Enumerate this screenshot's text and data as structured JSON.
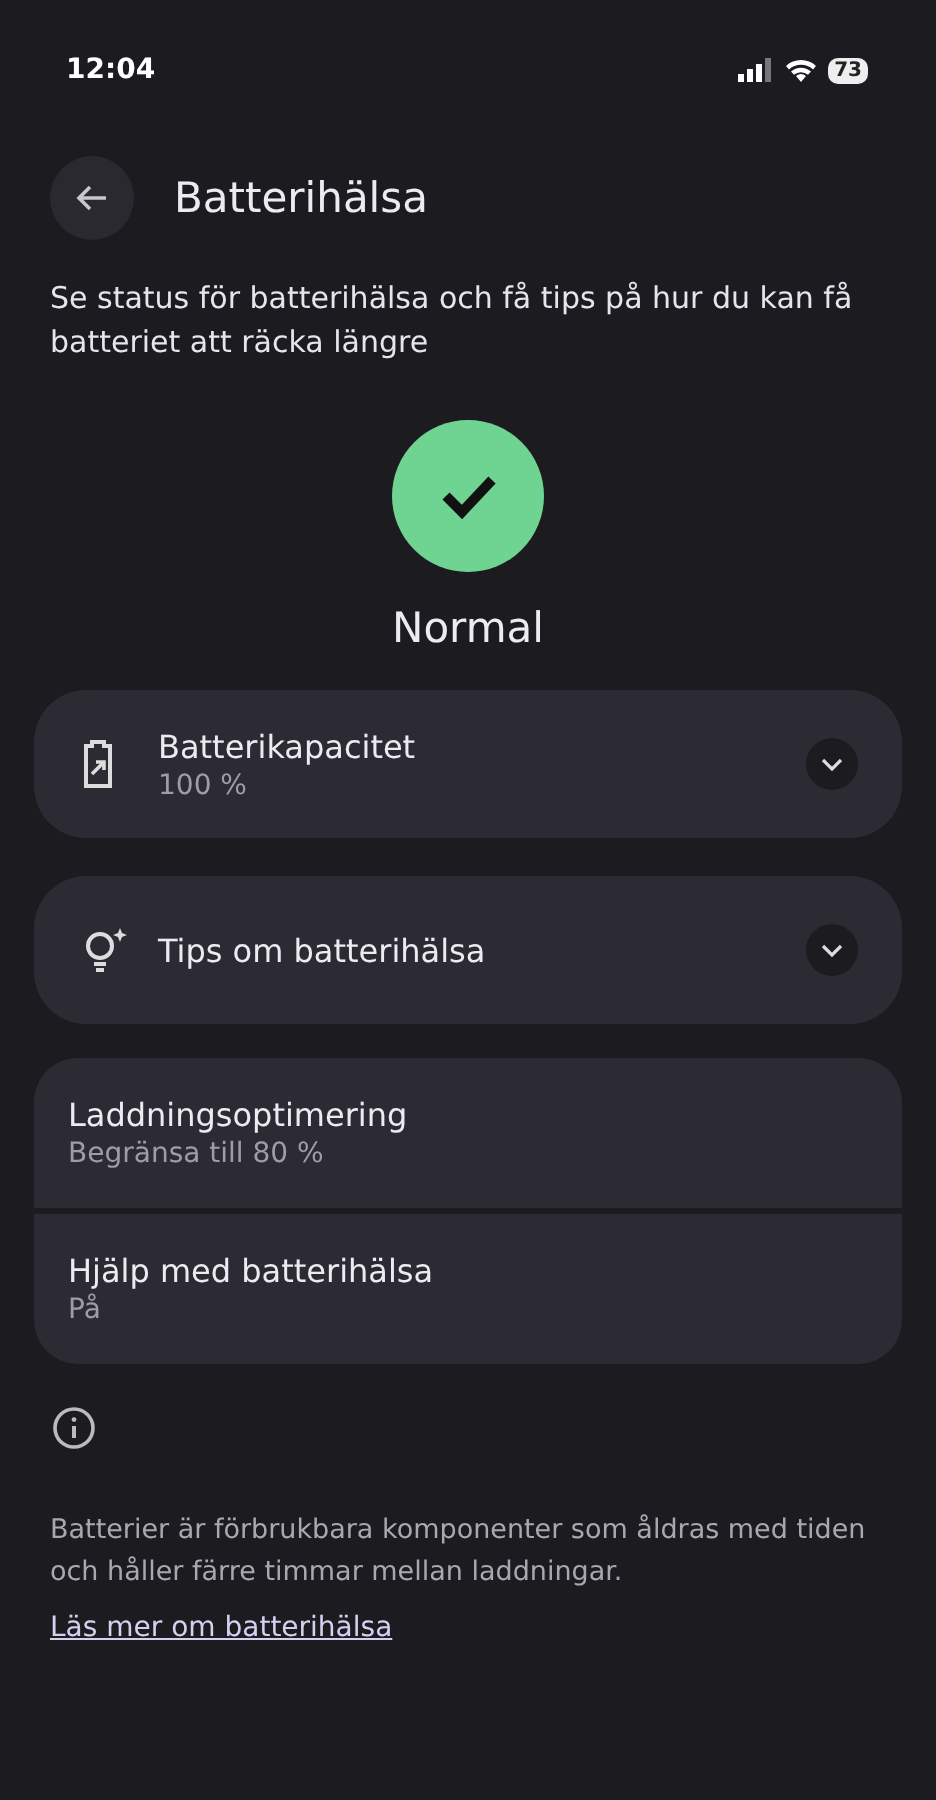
{
  "status_bar": {
    "time": "12:04",
    "battery": "73"
  },
  "header": {
    "title": "Batterihälsa"
  },
  "description": "Se status för batterihälsa och få tips på hur du kan få batteriet att räcka längre",
  "status": {
    "label": "Normal"
  },
  "expandables": [
    {
      "kind": "battery",
      "title": "Batterikapacitet",
      "subtitle": "100 %",
      "expanded": false
    },
    {
      "kind": "tips",
      "title": "Tips om batterihälsa",
      "expanded": false
    }
  ],
  "settings": [
    {
      "title": "Laddningsoptimering",
      "subtitle": "Begränsa till 80 %"
    },
    {
      "title": "Hjälp med batterihälsa",
      "subtitle": "På"
    }
  ],
  "footer": {
    "text": "Batterier är förbrukbara komponenter som åldras med tiden och håller färre timmar mellan laddningar.",
    "link": "Läs mer om batterihälsa"
  }
}
